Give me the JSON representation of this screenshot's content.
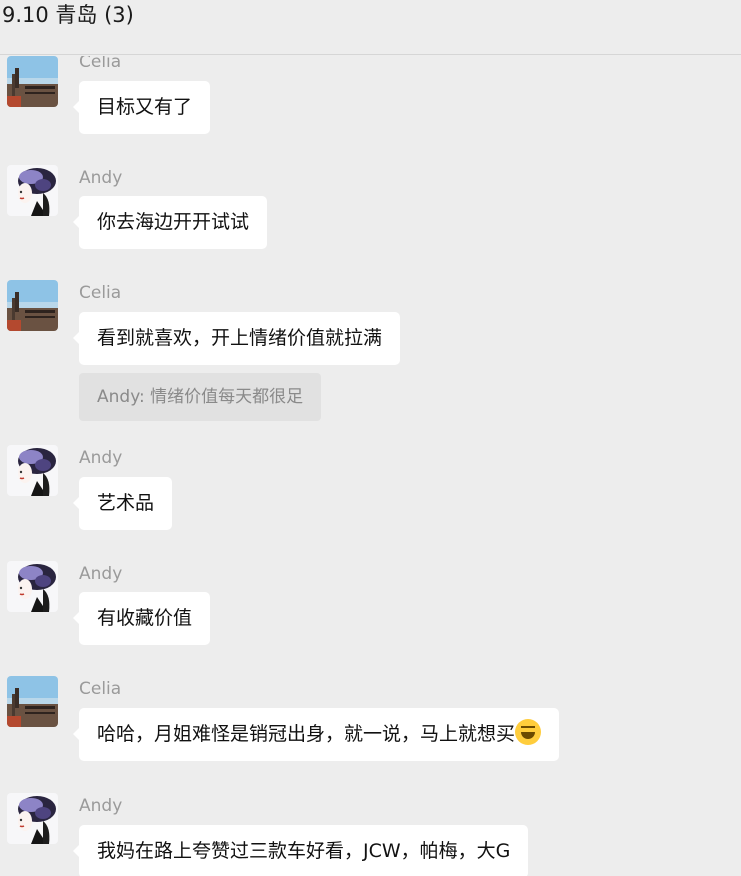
{
  "header": {
    "title": "9.10 青岛 (3)"
  },
  "messages": [
    {
      "sender": "Celia",
      "text": "目标又有了",
      "avatar": "celia-avatar"
    },
    {
      "sender": "Andy",
      "text": "你去海边开开试试",
      "avatar": "andy-avatar"
    },
    {
      "sender": "Celia",
      "text": "看到就喜欢，开上情绪价值就拉满",
      "avatar": "celia-avatar",
      "quote": "Andy: 情绪价值每天都很足"
    },
    {
      "sender": "Andy",
      "text": "艺术品",
      "avatar": "andy-avatar"
    },
    {
      "sender": "Andy",
      "text": "有收藏价值",
      "avatar": "andy-avatar"
    },
    {
      "sender": "Celia",
      "text": "哈哈，月姐难怪是销冠出身，就一说，马上就想买",
      "avatar": "celia-avatar",
      "emoji": "laughing-tears-emoji"
    },
    {
      "sender": "Andy",
      "text": "我妈在路上夸赞过三款车好看，JCW，帕梅，大G",
      "avatar": "andy-avatar"
    }
  ]
}
